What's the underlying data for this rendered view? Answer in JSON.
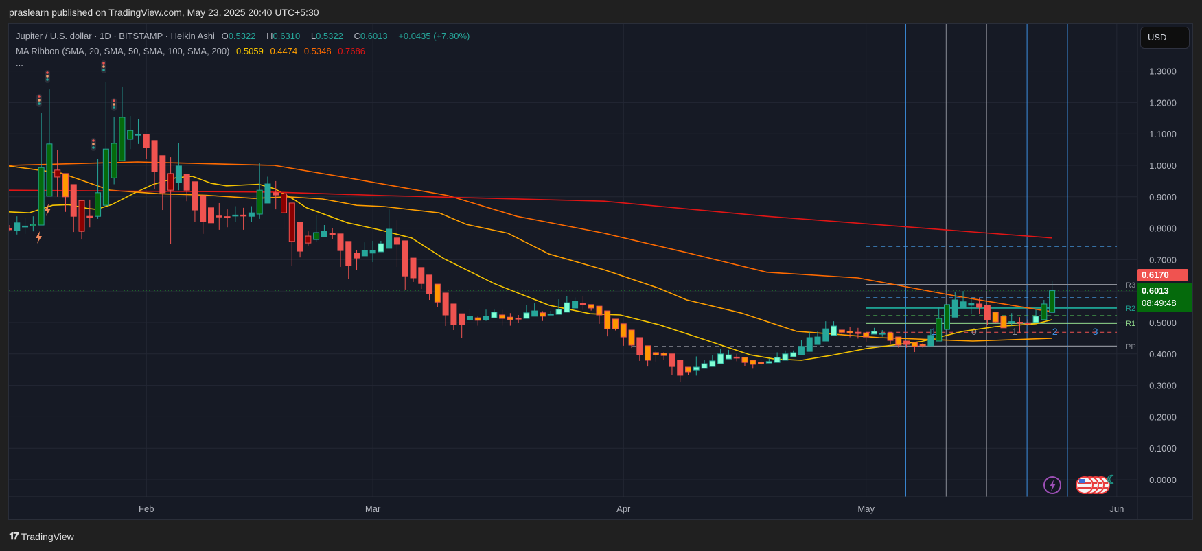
{
  "header": {
    "published": "praslearn published on TradingView.com, May 23, 2025 20:40 UTC+5:30"
  },
  "legend": {
    "symbol": "Jupiter / U.S. dollar · 1D · BITSTAMP · Heikin Ashi",
    "o_label": "O",
    "o": "0.5322",
    "h_label": "H",
    "h": "0.6310",
    "l_label": "L",
    "l": "0.5322",
    "c_label": "C",
    "c": "0.6013",
    "change": "+0.0435 (+7.80%)",
    "ma_title": "MA Ribbon (SMA, 20, SMA, 50, SMA, 100, SMA, 200)",
    "ma_values": [
      "0.5059",
      "0.4474",
      "0.5348",
      "0.7686"
    ],
    "more": "..."
  },
  "currency_button": "USD",
  "price_labels": {
    "alert_price": "0.6170",
    "last_price": "0.6013",
    "countdown": "08:49:48"
  },
  "footer": {
    "logo_text": "TradingView",
    "logo_mark": "TV"
  },
  "colors": {
    "up_strong": "#056a0c",
    "up": "#26a69a",
    "up_light": "#7fffd4",
    "down": "#ef5350",
    "down_dark": "#8b0000",
    "down_orange": "#ff9800",
    "ma20": "#f5c400",
    "ma50": "#ff9f00",
    "ma100": "#ff6a00",
    "ma200": "#e01515"
  },
  "chart_data": {
    "type": "candlestick",
    "title": "Jupiter / U.S. dollar · 1D · BITSTAMP · Heikin Ashi",
    "x_start": "2025-01-15",
    "x_end": "2025-05-23",
    "x_ticks": [
      "Feb",
      "Mar",
      "Apr",
      "May",
      "Jun"
    ],
    "x_tick_day_index": [
      17,
      45,
      76,
      106,
      137
    ],
    "y_ticks": [
      "0.0000",
      "0.1000",
      "0.2000",
      "0.3000",
      "0.4000",
      "0.5000",
      "0.6000",
      "0.7000",
      "0.8000",
      "0.9000",
      "1.0000",
      "1.1000",
      "1.2000",
      "1.3000"
    ],
    "ylim": [
      -0.05,
      1.4
    ],
    "grid": true,
    "candles_format": [
      "open",
      "high",
      "low",
      "close",
      "color_class"
    ],
    "candles": [
      [
        0.8,
        0.81,
        0.79,
        0.795,
        "r"
      ],
      [
        0.793,
        0.838,
        0.78,
        0.817,
        "t"
      ],
      [
        0.806,
        0.834,
        0.782,
        0.807,
        "t"
      ],
      [
        0.808,
        0.838,
        0.79,
        0.812,
        "g"
      ],
      [
        0.81,
        1.168,
        0.81,
        0.993,
        "g"
      ],
      [
        0.902,
        1.242,
        0.902,
        1.068,
        "g"
      ],
      [
        0.985,
        1.05,
        0.9,
        0.963,
        "d"
      ],
      [
        0.974,
        0.974,
        0.852,
        0.9,
        "o"
      ],
      [
        0.939,
        0.939,
        0.788,
        0.838,
        "r"
      ],
      [
        0.888,
        0.888,
        0.764,
        0.79,
        "d"
      ],
      [
        0.838,
        0.891,
        0.803,
        0.836,
        "r"
      ],
      [
        0.838,
        1.02,
        0.83,
        0.913,
        "g"
      ],
      [
        0.873,
        1.266,
        0.873,
        1.052,
        "g"
      ],
      [
        0.96,
        1.153,
        0.94,
        1.07,
        "g"
      ],
      [
        1.015,
        1.249,
        1.015,
        1.153,
        "g"
      ],
      [
        1.083,
        1.157,
        1.052,
        1.111,
        "g"
      ],
      [
        1.097,
        1.148,
        1.068,
        1.099,
        "t"
      ],
      [
        1.098,
        1.098,
        1.02,
        1.057,
        "r"
      ],
      [
        1.079,
        1.079,
        0.924,
        0.98,
        "r"
      ],
      [
        1.031,
        1.031,
        0.858,
        0.913,
        "r"
      ],
      [
        0.974,
        1.026,
        0.751,
        0.921,
        "d"
      ],
      [
        0.945,
        1.07,
        0.921,
        0.998,
        "t"
      ],
      [
        0.972,
        0.972,
        0.886,
        0.921,
        "r"
      ],
      [
        0.948,
        0.948,
        0.821,
        0.858,
        "r"
      ],
      [
        0.904,
        0.904,
        0.782,
        0.821,
        "r"
      ],
      [
        0.865,
        0.865,
        0.786,
        0.817,
        "r"
      ],
      [
        0.839,
        0.88,
        0.795,
        0.837,
        "r"
      ],
      [
        0.837,
        0.86,
        0.803,
        0.835,
        "r"
      ],
      [
        0.839,
        0.87,
        0.82,
        0.842,
        "t"
      ],
      [
        0.842,
        0.865,
        0.795,
        0.84,
        "r"
      ],
      [
        0.838,
        0.87,
        0.82,
        0.849,
        "t"
      ],
      [
        0.845,
        1.007,
        0.83,
        0.921,
        "g"
      ],
      [
        0.88,
        0.964,
        0.88,
        0.941,
        "t"
      ],
      [
        0.913,
        0.95,
        0.86,
        0.906,
        "r"
      ],
      [
        0.91,
        0.91,
        0.801,
        0.849,
        "d"
      ],
      [
        0.88,
        0.88,
        0.679,
        0.758,
        "d"
      ],
      [
        0.819,
        0.819,
        0.707,
        0.727,
        "r"
      ],
      [
        0.775,
        0.79,
        0.745,
        0.753,
        "d"
      ],
      [
        0.764,
        0.841,
        0.758,
        0.786,
        "g"
      ],
      [
        0.773,
        0.81,
        0.773,
        0.79,
        "t"
      ],
      [
        0.783,
        0.8,
        0.765,
        0.781,
        "r"
      ],
      [
        0.782,
        0.782,
        0.677,
        0.729,
        "r"
      ],
      [
        0.758,
        0.758,
        0.638,
        0.681,
        "r"
      ],
      [
        0.721,
        0.731,
        0.668,
        0.705,
        "r"
      ],
      [
        0.712,
        0.755,
        0.712,
        0.729,
        "t"
      ],
      [
        0.721,
        0.76,
        0.692,
        0.729,
        "t"
      ],
      [
        0.725,
        0.76,
        0.725,
        0.751,
        "m"
      ],
      [
        0.736,
        0.86,
        0.736,
        0.797,
        "t"
      ],
      [
        0.769,
        0.825,
        0.677,
        0.749,
        "r"
      ],
      [
        0.76,
        0.76,
        0.605,
        0.648,
        "r"
      ],
      [
        0.705,
        0.705,
        0.629,
        0.642,
        "r"
      ],
      [
        0.675,
        0.675,
        0.607,
        0.624,
        "r"
      ],
      [
        0.651,
        0.651,
        0.572,
        0.592,
        "r"
      ],
      [
        0.622,
        0.622,
        0.548,
        0.565,
        "o"
      ],
      [
        0.594,
        0.594,
        0.489,
        0.524,
        "r"
      ],
      [
        0.559,
        0.559,
        0.476,
        0.493,
        "r"
      ],
      [
        0.528,
        0.528,
        0.45,
        0.493,
        "r"
      ],
      [
        0.509,
        0.542,
        0.505,
        0.52,
        "t"
      ],
      [
        0.515,
        0.52,
        0.49,
        0.507,
        "o"
      ],
      [
        0.509,
        0.541,
        0.505,
        0.52,
        "t"
      ],
      [
        0.515,
        0.541,
        0.515,
        0.533,
        "m"
      ],
      [
        0.524,
        0.54,
        0.49,
        0.513,
        "o"
      ],
      [
        0.517,
        0.53,
        0.49,
        0.509,
        "o"
      ],
      [
        0.514,
        0.524,
        0.5,
        0.512,
        "r"
      ],
      [
        0.513,
        0.555,
        0.513,
        0.531,
        "m"
      ],
      [
        0.52,
        0.561,
        0.52,
        0.537,
        "t"
      ],
      [
        0.531,
        0.536,
        0.505,
        0.52,
        "o"
      ],
      [
        0.526,
        0.537,
        0.523,
        0.527,
        "t"
      ],
      [
        0.526,
        0.574,
        0.526,
        0.542,
        "m"
      ],
      [
        0.533,
        0.585,
        0.533,
        0.563,
        "m"
      ],
      [
        0.546,
        0.58,
        0.546,
        0.568,
        "t"
      ],
      [
        0.56,
        0.585,
        0.54,
        0.558,
        "r"
      ],
      [
        0.557,
        0.557,
        0.538,
        0.546,
        "o"
      ],
      [
        0.552,
        0.552,
        0.496,
        0.524,
        "o"
      ],
      [
        0.537,
        0.537,
        0.456,
        0.48,
        "o"
      ],
      [
        0.511,
        0.511,
        0.475,
        0.48,
        "o"
      ],
      [
        0.496,
        0.496,
        0.426,
        0.454,
        "o"
      ],
      [
        0.476,
        0.476,
        0.419,
        0.428,
        "o"
      ],
      [
        0.452,
        0.452,
        0.378,
        0.397,
        "r"
      ],
      [
        0.426,
        0.426,
        0.36,
        0.38,
        "o"
      ],
      [
        0.404,
        0.411,
        0.376,
        0.397,
        "o"
      ],
      [
        0.402,
        0.406,
        0.382,
        0.395,
        "o"
      ],
      [
        0.4,
        0.4,
        0.334,
        0.36,
        "r"
      ],
      [
        0.38,
        0.38,
        0.31,
        0.332,
        "r"
      ],
      [
        0.358,
        0.358,
        0.332,
        0.343,
        "o"
      ],
      [
        0.349,
        0.392,
        0.331,
        0.358,
        "m"
      ],
      [
        0.354,
        0.38,
        0.354,
        0.369,
        "m"
      ],
      [
        0.36,
        0.397,
        0.36,
        0.378,
        "m"
      ],
      [
        0.369,
        0.415,
        0.369,
        0.4,
        "m"
      ],
      [
        0.384,
        0.413,
        0.384,
        0.397,
        "m"
      ],
      [
        0.39,
        0.4,
        0.377,
        0.389,
        "r"
      ],
      [
        0.389,
        0.389,
        0.361,
        0.373,
        "o"
      ],
      [
        0.38,
        0.38,
        0.353,
        0.367,
        "o"
      ],
      [
        0.373,
        0.38,
        0.36,
        0.369,
        "o"
      ],
      [
        0.371,
        0.385,
        0.371,
        0.376,
        "m"
      ],
      [
        0.373,
        0.405,
        0.373,
        0.389,
        "m"
      ],
      [
        0.38,
        0.411,
        0.38,
        0.4,
        "m"
      ],
      [
        0.391,
        0.411,
        0.391,
        0.404,
        "m"
      ],
      [
        0.397,
        0.445,
        0.397,
        0.424,
        "t"
      ],
      [
        0.408,
        0.469,
        0.408,
        0.452,
        "t"
      ],
      [
        0.43,
        0.471,
        0.43,
        0.454,
        "t"
      ],
      [
        0.441,
        0.504,
        0.441,
        0.48,
        "t"
      ],
      [
        0.459,
        0.504,
        0.459,
        0.489,
        "m"
      ],
      [
        0.476,
        0.476,
        0.462,
        0.469,
        "o"
      ],
      [
        0.472,
        0.485,
        0.453,
        0.467,
        "o"
      ],
      [
        0.469,
        0.483,
        0.449,
        0.465,
        "r"
      ],
      [
        0.467,
        0.467,
        0.439,
        0.454,
        "o"
      ],
      [
        0.463,
        0.483,
        0.463,
        0.472,
        "m"
      ],
      [
        0.465,
        0.476,
        0.455,
        0.466,
        "t"
      ],
      [
        0.467,
        0.467,
        0.432,
        0.443,
        "o"
      ],
      [
        0.454,
        0.454,
        0.42,
        0.428,
        "o"
      ],
      [
        0.441,
        0.441,
        0.42,
        0.43,
        "r"
      ],
      [
        0.437,
        0.437,
        0.406,
        0.424,
        "o"
      ],
      [
        0.43,
        0.434,
        0.42,
        0.426,
        "o"
      ],
      [
        0.426,
        0.48,
        0.426,
        0.459,
        "t"
      ],
      [
        0.441,
        0.55,
        0.441,
        0.513,
        "g"
      ],
      [
        0.478,
        0.574,
        0.478,
        0.557,
        "g"
      ],
      [
        0.517,
        0.596,
        0.517,
        0.572,
        "t"
      ],
      [
        0.546,
        0.6,
        0.546,
        0.566,
        "t"
      ],
      [
        0.555,
        0.58,
        0.528,
        0.561,
        "t"
      ],
      [
        0.559,
        0.578,
        0.528,
        0.548,
        "r"
      ],
      [
        0.555,
        0.555,
        0.493,
        0.509,
        "r"
      ],
      [
        0.533,
        0.533,
        0.498,
        0.502,
        "o"
      ],
      [
        0.52,
        0.52,
        0.483,
        0.483,
        "o"
      ],
      [
        0.501,
        0.53,
        0.49,
        0.503,
        "t"
      ],
      [
        0.501,
        0.517,
        0.465,
        0.499,
        "r"
      ],
      [
        0.499,
        0.51,
        0.49,
        0.497,
        "r"
      ],
      [
        0.5,
        0.54,
        0.5,
        0.52,
        "m"
      ],
      [
        0.509,
        0.572,
        0.509,
        0.559,
        "g"
      ],
      [
        0.5322,
        0.631,
        0.5322,
        0.6013,
        "g"
      ]
    ],
    "moving_averages": [
      {
        "name": "SMA 20",
        "color_key": "ma20",
        "points": [
          [
            0,
            0.852
          ],
          [
            2.5,
            0.849
          ],
          [
            5.4,
            0.873
          ],
          [
            7.4,
            0.875
          ],
          [
            9.7,
            0.863
          ],
          [
            10.8,
            0.86
          ],
          [
            12.7,
            0.875
          ],
          [
            15.6,
            0.913
          ],
          [
            17.8,
            0.939
          ],
          [
            20.7,
            0.961
          ],
          [
            22.7,
            0.965
          ],
          [
            25,
            0.943
          ],
          [
            26.9,
            0.935
          ],
          [
            30.9,
            0.94
          ],
          [
            32.9,
            0.925
          ],
          [
            35.4,
            0.889
          ],
          [
            36.8,
            0.865
          ],
          [
            41.9,
            0.817
          ],
          [
            45.8,
            0.795
          ],
          [
            49.8,
            0.769
          ],
          [
            53.8,
            0.703
          ],
          [
            60,
            0.624
          ],
          [
            66.8,
            0.555
          ],
          [
            71.9,
            0.528
          ],
          [
            75.6,
            0.524
          ],
          [
            80.4,
            0.493
          ],
          [
            86.1,
            0.445
          ],
          [
            91.7,
            0.397
          ],
          [
            94.6,
            0.384
          ],
          [
            98,
            0.38
          ],
          [
            101.6,
            0.395
          ],
          [
            106,
            0.417
          ],
          [
            112.9,
            0.44
          ],
          [
            118,
            0.472
          ],
          [
            122,
            0.487
          ],
          [
            127,
            0.496
          ],
          [
            129,
            0.509
          ]
        ]
      },
      {
        "name": "SMA 50",
        "color_key": "ma50",
        "points": [
          [
            0,
            0.998
          ],
          [
            6.5,
            0.975
          ],
          [
            12.5,
            0.921
          ],
          [
            18.4,
            0.91
          ],
          [
            24.4,
            0.905
          ],
          [
            30.3,
            0.895
          ],
          [
            34.5,
            0.9
          ],
          [
            38.8,
            0.893
          ],
          [
            43,
            0.873
          ],
          [
            46.4,
            0.869
          ],
          [
            53.2,
            0.849
          ],
          [
            56.6,
            0.812
          ],
          [
            61.7,
            0.784
          ],
          [
            66.8,
            0.718
          ],
          [
            73.6,
            0.668
          ],
          [
            80.4,
            0.609
          ],
          [
            83.8,
            0.572
          ],
          [
            90.6,
            0.53
          ],
          [
            97.4,
            0.472
          ],
          [
            107.6,
            0.452
          ],
          [
            119.2,
            0.441
          ],
          [
            129,
            0.45
          ]
        ]
      },
      {
        "name": "SMA 100",
        "color_key": "ma100",
        "points": [
          [
            0,
            1.0
          ],
          [
            15.9,
            1.011
          ],
          [
            32.8,
            1.0
          ],
          [
            42.4,
            0.958
          ],
          [
            54.3,
            0.904
          ],
          [
            62.8,
            0.838
          ],
          [
            73.6,
            0.784
          ],
          [
            84.2,
            0.72
          ],
          [
            93.7,
            0.66
          ],
          [
            105,
            0.642
          ],
          [
            117.4,
            0.583
          ],
          [
            127.7,
            0.539
          ],
          [
            129,
            0.535
          ]
        ]
      },
      {
        "name": "SMA 200",
        "color_key": "ma200",
        "points": [
          [
            0,
            0.921
          ],
          [
            32.8,
            0.915
          ],
          [
            46.4,
            0.904
          ],
          [
            73.6,
            0.886
          ],
          [
            93.7,
            0.838
          ],
          [
            129,
            0.769
          ]
        ]
      }
    ],
    "pivots": {
      "labels": [
        "R3",
        "R2",
        "R1",
        "PP"
      ],
      "levels": [
        0.62,
        0.546,
        0.498,
        0.424
      ],
      "dashed_levels": [
        0.742,
        0.579,
        0.522,
        0.469
      ],
      "start_day": 106,
      "end_day": 136
    },
    "cycle_lines": {
      "labels": [
        "1",
        "0",
        "1",
        "2",
        "3"
      ],
      "days": [
        113,
        118,
        123,
        128,
        133
      ]
    }
  }
}
